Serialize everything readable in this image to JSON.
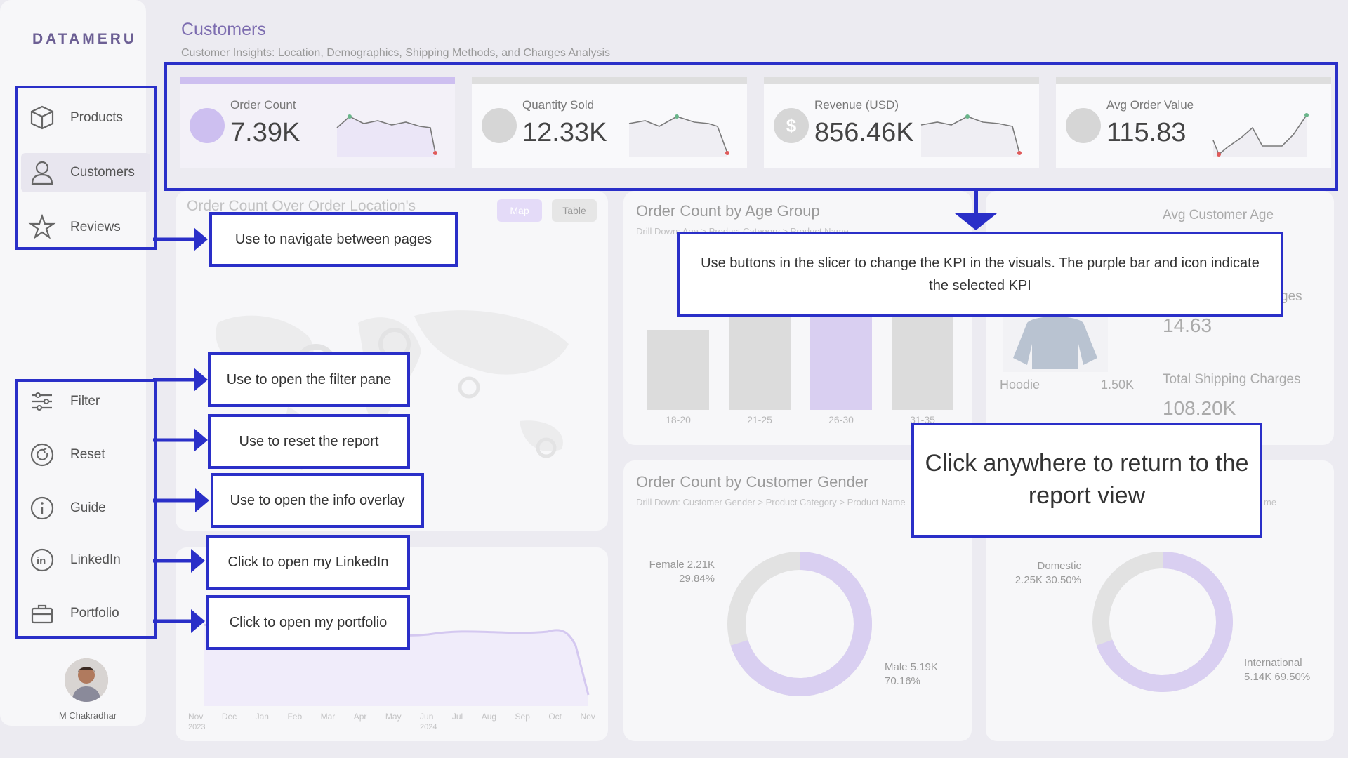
{
  "brand": "DATAMERU",
  "nav": [
    {
      "label": "Products",
      "icon": "box-icon"
    },
    {
      "label": "Customers",
      "icon": "user-icon"
    },
    {
      "label": "Reviews",
      "icon": "star-icon"
    }
  ],
  "tools": [
    {
      "label": "Filter",
      "icon": "filter-sliders-icon"
    },
    {
      "label": "Reset",
      "icon": "reset-icon"
    },
    {
      "label": "Guide",
      "icon": "info-icon"
    },
    {
      "label": "LinkedIn",
      "icon": "linkedin-icon"
    },
    {
      "label": "Portfolio",
      "icon": "briefcase-icon"
    }
  ],
  "user_name": "M Chakradhar",
  "header": {
    "title": "Customers",
    "subtitle": "Customer Insights: Location, Demographics, Shipping Methods, and Charges Analysis"
  },
  "kpis": [
    {
      "label": "Order Count",
      "value": "7.39K",
      "icon": "bag-icon",
      "selected": true
    },
    {
      "label": "Quantity Sold",
      "value": "12.33K",
      "icon": "boxes-icon",
      "selected": false
    },
    {
      "label": "Revenue (USD)",
      "value": "856.46K",
      "icon": "dollar-icon",
      "selected": false
    },
    {
      "label": "Avg Order Value",
      "value": "115.83",
      "icon": "chart-icon",
      "selected": false
    }
  ],
  "map_card": {
    "title": "Order Count Over Order Location's",
    "toggle_map": "Map",
    "toggle_table": "Table"
  },
  "age_card": {
    "title": "Order Count by Age Group",
    "drill": "Drill Down: Age > Product Category > Product Name",
    "categories": [
      "18-20",
      "21-25",
      "26-30",
      "31-35"
    ]
  },
  "right_stats": {
    "avg_age_label": "Avg Customer Age",
    "partial_label": "ges",
    "value_1": "14.63",
    "product_name": "Hoodie",
    "product_value": "1.50K",
    "shipping_label": "Total Shipping Charges",
    "shipping_value": "108.20K"
  },
  "gender_card": {
    "title": "Order Count by Customer Gender",
    "drill": "Drill Down: Customer Gender > Product Category > Product Name",
    "female_label": "Female 2.21K",
    "female_pct": "29.84%",
    "male_label": "Male 5.19K",
    "male_pct": "70.16%"
  },
  "shipping_card": {
    "partial": "me",
    "domestic_label": "Domestic",
    "domestic_value": "2.25K 30.50%",
    "intl_label": "International",
    "intl_value": "5.14K 69.50%"
  },
  "trend_card": {
    "months": [
      "Nov",
      "Dec",
      "Jan",
      "Feb",
      "Mar",
      "Apr",
      "May",
      "Jun",
      "Jul",
      "Aug",
      "Sep",
      "Oct",
      "Nov"
    ],
    "year_start": "2023",
    "year_end": "2024"
  },
  "callouts": {
    "navigate": "Use to navigate between pages",
    "kpi": "Use buttons in the slicer to change the KPI in the visuals. The purple bar and icon indicate the selected KPI",
    "filter": "Use to open the filter pane",
    "reset": "Use to reset the report",
    "info": "Use to open the info overlay",
    "linkedin": "Click to open my LinkedIn",
    "portfolio": "Click to open my portfolio",
    "return": "Click anywhere to return to the report view"
  },
  "colors": {
    "accent": "#cdbff0",
    "callout_border": "#2a2fc8",
    "title": "#7d6db0"
  }
}
